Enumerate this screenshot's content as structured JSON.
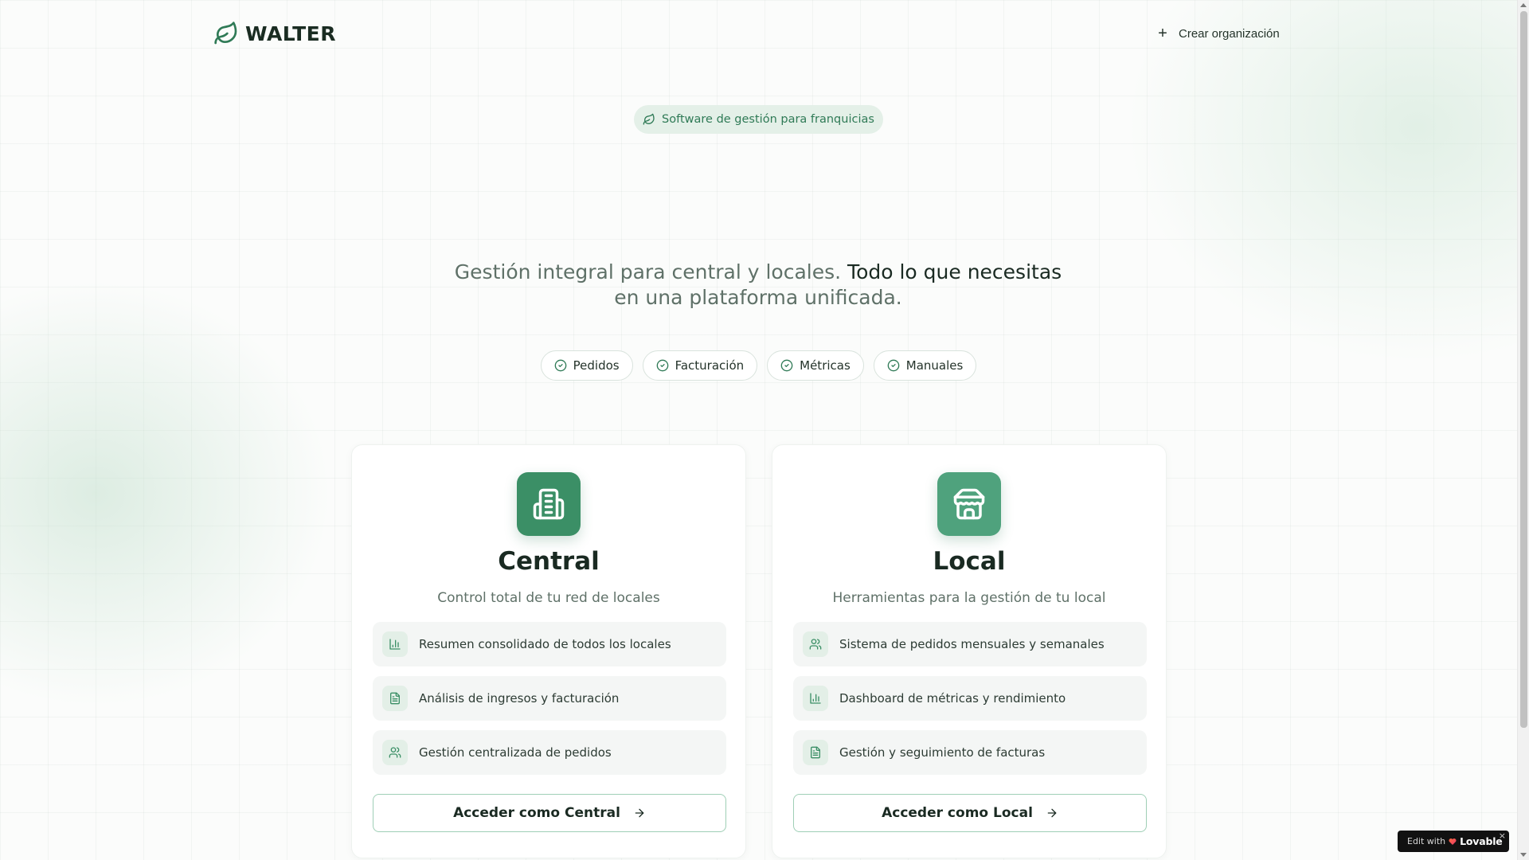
{
  "header": {
    "brand_name": "WALTER",
    "create_org_label": "Crear organización"
  },
  "badge": {
    "label": "Software de gestión para franquicias"
  },
  "hero": {
    "part1": "Gestión integral para central y locales. ",
    "part2_highlight": "Todo lo que necesitas",
    "part3": " en una plataforma unificada."
  },
  "chips": [
    {
      "label": "Pedidos"
    },
    {
      "label": "Facturación"
    },
    {
      "label": "Métricas"
    },
    {
      "label": "Manuales"
    }
  ],
  "cards": {
    "central": {
      "title": "Central",
      "subtitle": "Control total de tu red de locales",
      "icon": "building-icon",
      "features": [
        {
          "label": "Resumen consolidado de todos los locales",
          "icon": "bar-chart-icon"
        },
        {
          "label": "Análisis de ingresos y facturación",
          "icon": "document-icon"
        },
        {
          "label": "Gestión centralizada de pedidos",
          "icon": "users-icon"
        }
      ],
      "button_label": "Acceder como Central"
    },
    "local": {
      "title": "Local",
      "subtitle": "Herramientas para la gestión de tu local",
      "icon": "store-icon",
      "features": [
        {
          "label": "Sistema de pedidos mensuales y semanales",
          "icon": "users-icon"
        },
        {
          "label": "Dashboard de métricas y rendimiento",
          "icon": "bar-chart-icon"
        },
        {
          "label": "Gestión y seguimiento de facturas",
          "icon": "document-icon"
        }
      ],
      "button_label": "Acceder como Local"
    }
  },
  "lovable": {
    "prefix": "Edit with",
    "brand": "Lovable",
    "close": "×"
  },
  "colors": {
    "accent": "#3b8f66",
    "accent_light": "#e4f0e8",
    "text_dark": "#1a2a22",
    "text_muted": "#5f7168"
  }
}
